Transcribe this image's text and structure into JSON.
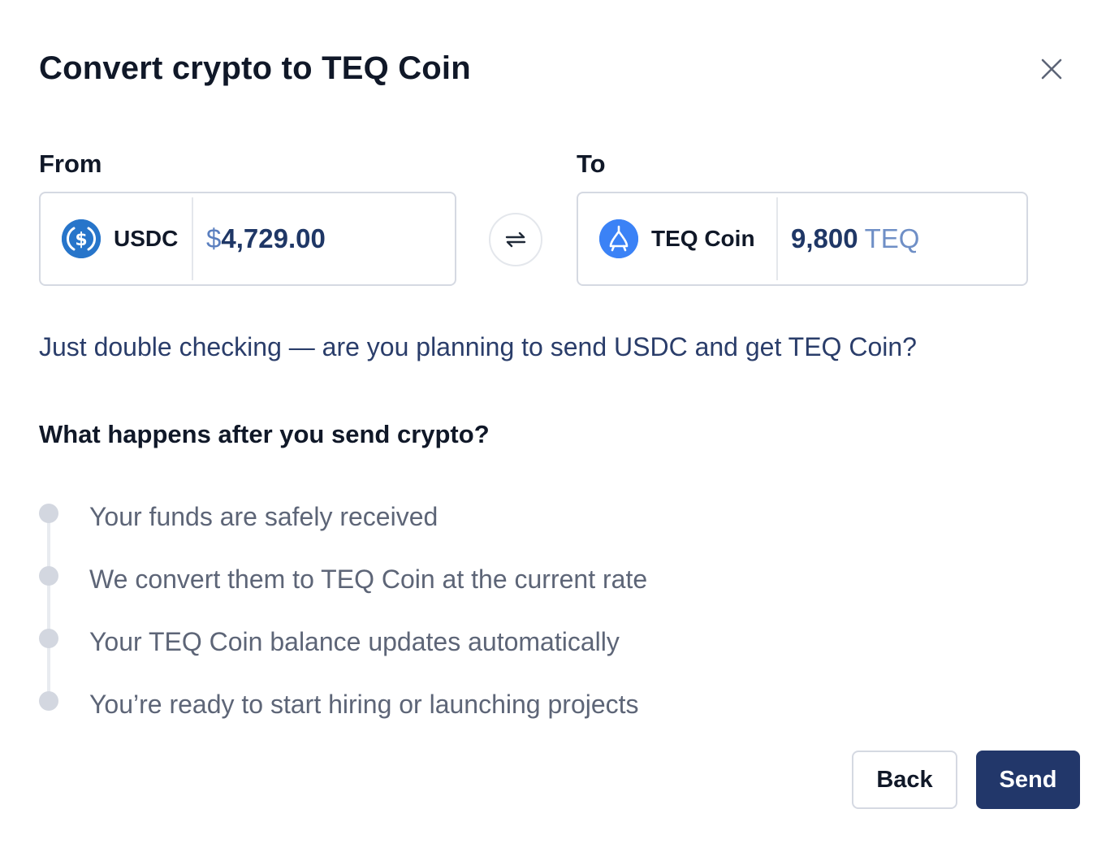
{
  "dialog": {
    "title": "Convert crypto to TEQ Coin",
    "close_icon": "close-icon"
  },
  "from": {
    "label": "From",
    "coin_name": "USDC",
    "coin_icon": "usdc-icon",
    "currency_symbol": "$",
    "amount": "4,729.00"
  },
  "swap": {
    "icon": "swap-arrows-icon"
  },
  "to": {
    "label": "To",
    "coin_name": "TEQ Coin",
    "coin_icon": "teq-coin-icon",
    "amount": "9,800",
    "unit": "TEQ"
  },
  "confirmation": {
    "text": "Just double checking — are you planning to send USDC and get TEQ Coin?"
  },
  "process": {
    "heading": "What happens after you send crypto?",
    "steps": [
      "Your funds are safely received",
      "We convert them to TEQ Coin at the current rate",
      "Your TEQ Coin balance updates automatically",
      "You’re ready to start hiring or launching projects"
    ]
  },
  "actions": {
    "back_label": "Back",
    "send_label": "Send"
  },
  "colors": {
    "primary": "#22376a",
    "usdc_blue": "#2775ca",
    "teq_blue": "#3b82f6",
    "border": "#d5d9e2"
  }
}
